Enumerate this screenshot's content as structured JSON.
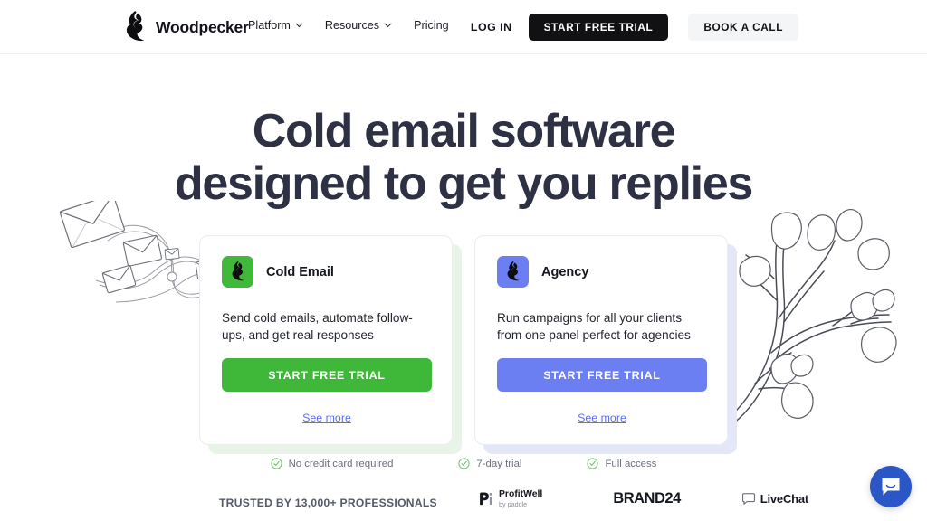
{
  "header": {
    "brand_name": "Woodpecker",
    "brand_logo_alt": "woodpecker-logo",
    "nav": [
      {
        "label": "Platform",
        "has_dropdown": true
      },
      {
        "label": "Resources",
        "has_dropdown": true
      },
      {
        "label": "Pricing",
        "has_dropdown": false
      }
    ],
    "login_label": "LOG IN",
    "primary_cta": "START FREE TRIAL",
    "secondary_cta": "BOOK A CALL"
  },
  "hero": {
    "title_line1": "Cold email software",
    "title_line2": "designed to get you replies",
    "title_color": "#2e3144"
  },
  "cards": [
    {
      "title": "Cold Email",
      "description": "Send cold emails, automate follow-ups, and get real responses",
      "cta": "START FREE TRIAL",
      "link": "See more",
      "accent": "#3fb839",
      "backdrop": "#e9f4e9",
      "icon": "woodpecker-logo"
    },
    {
      "title": "Agency",
      "description": "Run campaigns for all your clients from one panel perfect for agencies",
      "cta": "START FREE TRIAL",
      "link": "See more",
      "accent": "#6b7ff2",
      "backdrop": "#e3e7f7",
      "icon": "woodpecker-logo"
    }
  ],
  "features": [
    {
      "label": "No credit card required",
      "icon": "check-circle-icon"
    },
    {
      "label": "7-day trial",
      "icon": "check-circle-icon"
    },
    {
      "label": "Full access",
      "icon": "check-circle-icon"
    }
  ],
  "trusted": {
    "label": "TRUSTED BY 13,000+ PROFESSIONALS",
    "logos": [
      {
        "name": "ProfitWell",
        "sub": "by paddle"
      },
      {
        "name": "BRAND24"
      },
      {
        "name": "LiveChat"
      }
    ]
  },
  "chat_widget": {
    "icon": "chat-bubble-smile-icon",
    "color": "#2b57c6"
  },
  "decor": {
    "left": "flying-envelopes-illustration",
    "right": "tree-branch-leaves-illustration"
  }
}
